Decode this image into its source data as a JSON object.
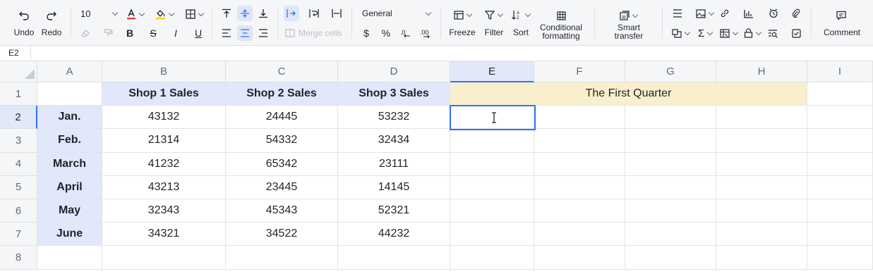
{
  "toolbar": {
    "undo_label": "Undo",
    "redo_label": "Redo",
    "font_size": "10",
    "merge_cells_label": "Merge cells",
    "number_format": "General",
    "currency_symbol": "$",
    "percent_symbol": "%",
    "freeze_label": "Freeze",
    "filter_label": "Filter",
    "sort_label": "Sort",
    "conditional_formatting_line1": "Conditional",
    "conditional_formatting_line2": "formatting",
    "smart_transfer_line1": "Smart",
    "smart_transfer_line2": "transfer",
    "comment_label": "Comment",
    "font_color": "#e8473f",
    "fill_color": "#f5d60c"
  },
  "namebox": {
    "value": "E2"
  },
  "grid": {
    "columns": [
      "A",
      "B",
      "C",
      "D",
      "E",
      "F",
      "G",
      "H",
      "I"
    ],
    "selected_column": "E",
    "selected_row": "2",
    "rows": [
      "1",
      "2",
      "3",
      "4",
      "5",
      "6",
      "7",
      "8"
    ],
    "headers": [
      "Shop 1 Sales",
      "Shop 2 Sales",
      "Shop 3 Sales"
    ],
    "merged_title": "The First Quarter",
    "months": [
      "Jan.",
      "Feb.",
      "March",
      "April",
      "May",
      "June"
    ],
    "data": [
      [
        "43132",
        "24445",
        "53232"
      ],
      [
        "21314",
        "54332",
        "32434"
      ],
      [
        "41232",
        "65342",
        "23111"
      ],
      [
        "43213",
        "23445",
        "14145"
      ],
      [
        "32343",
        "45343",
        "52321"
      ],
      [
        "34321",
        "34522",
        "44232"
      ]
    ],
    "accent_color": "#3370ff",
    "header_fill": "#e1e8fb",
    "title_fill": "#f9efcc"
  }
}
